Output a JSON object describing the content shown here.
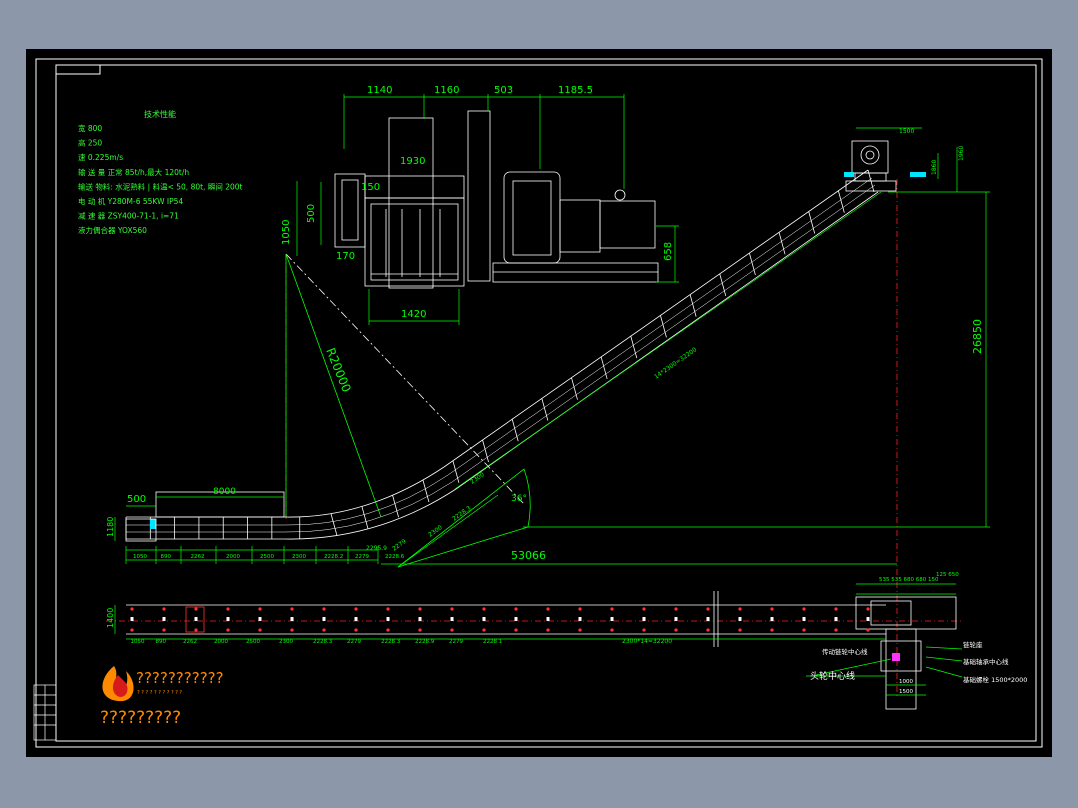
{
  "colors": {
    "background": "#8c98aa",
    "sheet": "#000000",
    "border": "#ffffff",
    "dimension": "#00ff00",
    "centerline": "#ff2020",
    "machine": "#ffffff",
    "text_green": "#33ff33",
    "accent_cyan": "#00e5ff",
    "magenta": "#ff33ff",
    "logo_orange": "#ff8a00"
  },
  "spec": {
    "heading": "技术性能",
    "lines": [
      "宽   800",
      "高   250",
      "速   0.225m/s",
      "输  送  量 正常 85t/h,最大 120t/h",
      "输送  物料: 水泥熟料 | 料温< 50, 80t, 瞬间 200t",
      "电  动  机  Y280M-6  55KW  IP54",
      "减  速  器  ZSY400-71-1,  i=71",
      "液力偶合器  YOX560"
    ]
  },
  "drive_dims": {
    "d1140": "1140",
    "d1160": "1160",
    "d503": "503",
    "d1185": "1185.5",
    "d1930": "1930",
    "d1050": "1050",
    "d500": "500",
    "d150": "150",
    "d170": "170",
    "d1420": "1420",
    "d658": "658"
  },
  "profile_dims": {
    "radius": "R20000",
    "angle": "36°",
    "total": "53066",
    "height": "26850",
    "d500": "500",
    "d8000": "8000",
    "d1180": "1180",
    "incline_pitch": "14*2300=32200",
    "pitch_a": "2300",
    "pitch_b": "2300",
    "pitch_c": "2228.3",
    "pitch_d": "2279",
    "pitch_e": "2295.9",
    "head_top": "1500",
    "head_side1": "1860",
    "head_side2": "1960"
  },
  "bottom_dims_profile": [
    "1050",
    "890",
    "2262",
    "2000",
    "2500",
    "2300",
    "2228.2",
    "2279",
    "2228.6"
  ],
  "bottom_dims_plan": [
    "1050",
    "890",
    "2262",
    "2000",
    "2500",
    "2300",
    "2228.3",
    "2279",
    "2228.3",
    "2228.9",
    "2279",
    "2228.1"
  ],
  "plan_dims": {
    "height": "1400",
    "span": "2300*14=32200",
    "head_top": "535 535 680 680 150",
    "head_top2": "125 650"
  },
  "callouts": {
    "c1": "传动链轮中心线",
    "c2": "头轮中心线",
    "c3": "链轮座",
    "c4": "基础轴承中心线",
    "c5": "基础螺栓 1500*2000",
    "c6": "头轮中心线",
    "w1": "1000",
    "w2": "1500"
  },
  "logo": {
    "title": "???????????",
    "subtitle": "? ? ? ? ? ? ? ? ? ? ?",
    "caption": "?????????"
  }
}
